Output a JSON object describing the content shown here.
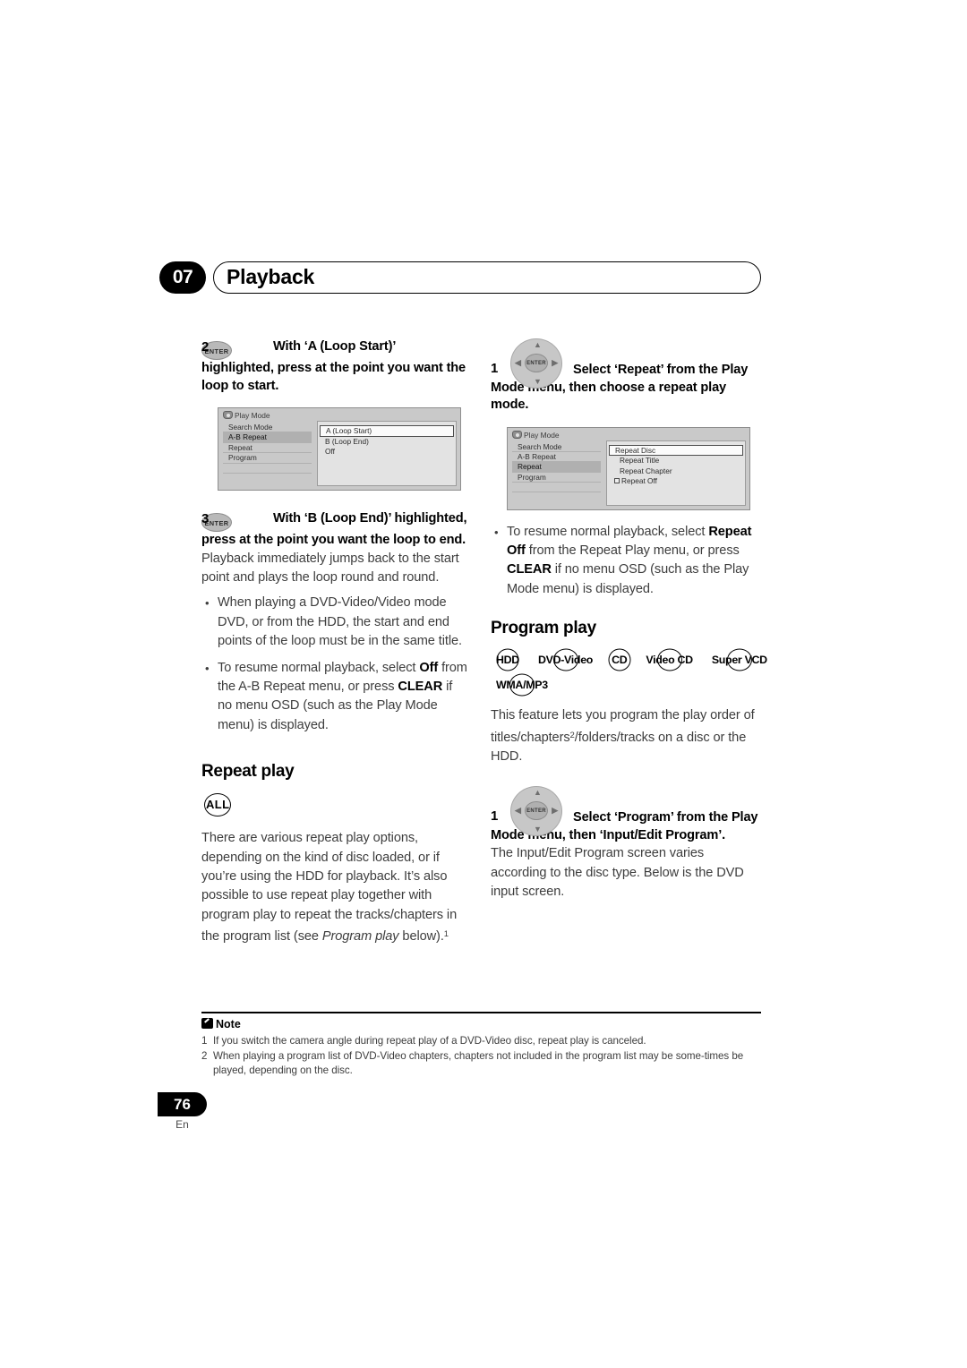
{
  "header": {
    "chapter_number": "07",
    "title": "Playback"
  },
  "left_column": {
    "step2": {
      "number": "2",
      "button_label": "ENTER",
      "text_bold": "With ‘A (Loop Start)’ highlighted, press at the point you want the loop to start."
    },
    "osd1": {
      "title": "Play Mode",
      "menu": [
        "Search Mode",
        "A-B Repeat",
        "Repeat",
        "Program"
      ],
      "selected_menu": "A-B Repeat",
      "options": [
        "A (Loop Start)",
        "B (Loop End)",
        "Off"
      ],
      "highlighted_option": "A (Loop Start)"
    },
    "step3": {
      "number": "3",
      "button_label": "ENTER",
      "text_bold": "With ‘B (Loop End)’ highlighted, press at the point you want the loop to end.",
      "text_body": "Playback immediately jumps back to the start point and plays the loop round and round."
    },
    "bullets": [
      "When playing a DVD-Video/Video mode DVD, or from the HDD, the start and end points of the loop must be in the same title.",
      "To resume normal playback, select Off from the A-B Repeat menu, or press CLEAR if no menu OSD (such as the Play Mode menu) is displayed."
    ],
    "bullet1_text": "When playing a DVD-Video/Video mode DVD, or from the HDD, the start and end points of the loop must be in the same title.",
    "bullet2_a": "To resume normal playback, select ",
    "bullet2_b": "Off",
    "bullet2_c": " from the A-B Repeat menu, or press ",
    "bullet2_d": "CLEAR",
    "bullet2_e": " if no menu OSD (such as the Play Mode menu) is displayed.",
    "repeat_play": {
      "heading": "Repeat play",
      "badge": "ALL",
      "paragraph_a": "There are various repeat play options, depending on the kind of disc loaded, or if you’re using the HDD for playback. It’s also possible to use repeat play together with program play to repeat the tracks/chapters in the program list (see ",
      "paragraph_italic": "Program play",
      "paragraph_b": " below).",
      "footnote_marker": "1"
    }
  },
  "right_column": {
    "step1_repeat": {
      "number": "1",
      "button_label": "ENTER",
      "text_bold": "Select ‘Repeat’ from the Play Mode menu, then choose a repeat play mode."
    },
    "osd2": {
      "title": "Play Mode",
      "menu": [
        "Search Mode",
        "A-B Repeat",
        "Repeat",
        "Program"
      ],
      "selected_menu": "Repeat",
      "options": [
        "Repeat Disc",
        "Repeat Title",
        "Repeat Chapter",
        "Repeat Off"
      ],
      "highlighted_option": "Repeat Disc",
      "checkbox_option": "Repeat Off"
    },
    "bullet_a": "To resume normal playback, select ",
    "bullet_b": "Repeat Off",
    "bullet_c": " from the Repeat Play menu, or press ",
    "bullet_d": "CLEAR",
    "bullet_e": " if no menu OSD (such as the Play Mode menu) is displayed.",
    "program_play": {
      "heading": "Program play",
      "badges_row1": [
        "HDD",
        "DVD-Video",
        "CD",
        "Video CD",
        "Super VCD"
      ],
      "badges_row2": [
        "WMA/MP3"
      ],
      "paragraph_a": "This feature lets you program the play order of titles/chapters",
      "footnote_marker": "2",
      "paragraph_b": "/folders/tracks on a disc or the HDD."
    },
    "step1_program": {
      "number": "1",
      "button_label": "ENTER",
      "text_bold": "Select ‘Program’ from the Play Mode menu, then ‘Input/Edit Program’.",
      "text_body": "The Input/Edit Program screen varies according to the disc type. Below is the DVD input screen."
    }
  },
  "note": {
    "heading": "Note",
    "items": [
      {
        "num": "1",
        "text": "If you switch the camera angle during repeat play of a DVD-Video disc, repeat play is canceled."
      },
      {
        "num": "2",
        "text": "When playing a program list of DVD-Video chapters, chapters not included in the program list may be some-times be played, depending on the disc."
      }
    ]
  },
  "footer": {
    "page_number": "76",
    "language": "En"
  },
  "colors": {
    "accent_black": "#000000",
    "osd_bg": "#c9c9c9",
    "osd_pane": "#e3e3e3",
    "body_text": "#3d3d3d"
  }
}
